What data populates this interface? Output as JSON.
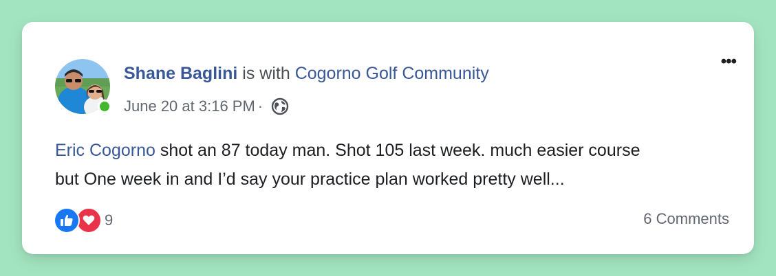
{
  "post": {
    "author": "Shane Baglini",
    "with_text": "is with",
    "group": "Cogorno Golf Community",
    "timestamp": "June 20 at 3:16 PM",
    "separator": "·",
    "privacy_icon": "globe-icon",
    "mention": "Eric Cogorno",
    "body_line1_rest": " shot an 87 today man. Shot 105 last week. much easier course",
    "body_line2": "but One week in and I’d say your practice plan worked pretty well...",
    "more_icon": "•••"
  },
  "footer": {
    "reaction_icons": [
      "like-icon",
      "love-icon"
    ],
    "reaction_count": "9",
    "comments_label": "6 Comments"
  },
  "colors": {
    "background": "#a3e4c0",
    "link": "#385898",
    "like": "#1877f2",
    "love": "#e8334a",
    "online": "#42b72a"
  }
}
